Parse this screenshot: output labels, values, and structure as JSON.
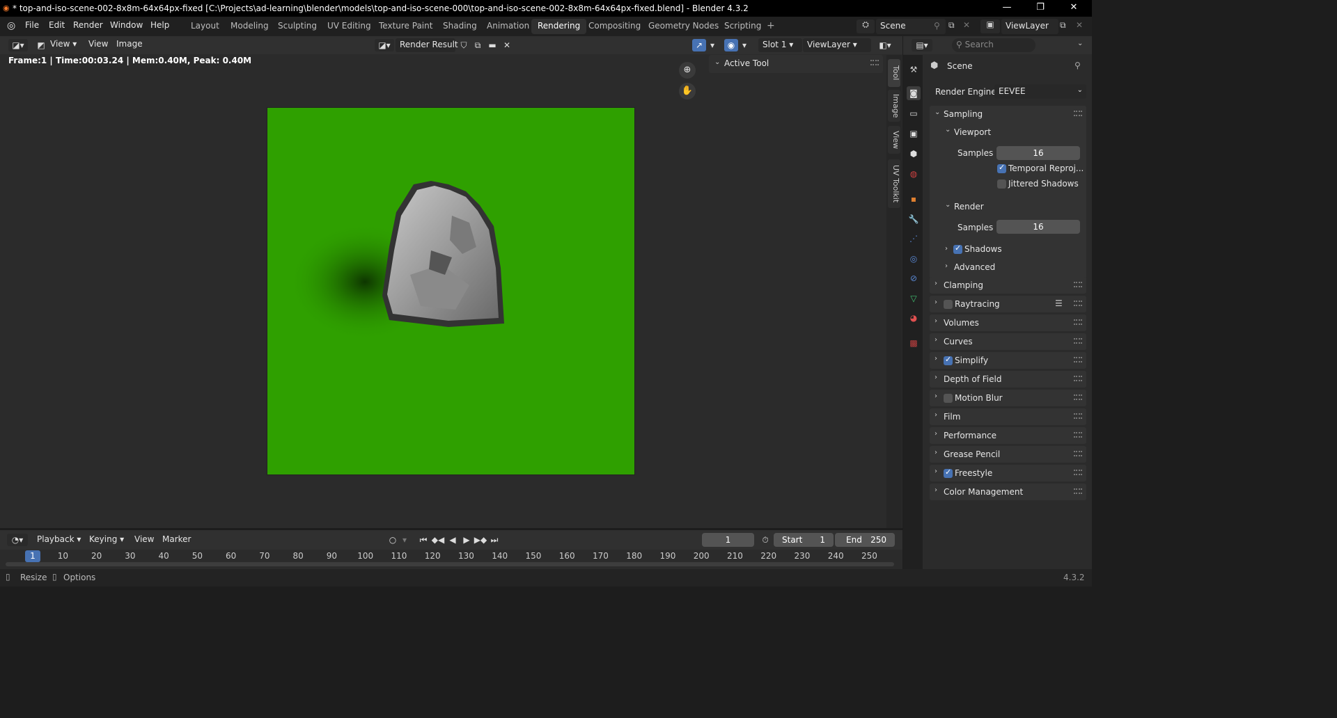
{
  "titlebar": {
    "title": "* top-and-iso-scene-002-8x8m-64x64px-fixed [C:\\Projects\\ad-learning\\blender\\models\\top-and-iso-scene-000\\top-and-iso-scene-002-8x8m-64x64px-fixed.blend] - Blender 4.3.2"
  },
  "menu": [
    "File",
    "Edit",
    "Render",
    "Window",
    "Help"
  ],
  "workspaces": [
    "Layout",
    "Modeling",
    "Sculpting",
    "UV Editing",
    "Texture Paint",
    "Shading",
    "Animation",
    "Rendering",
    "Compositing",
    "Geometry Nodes",
    "Scripting"
  ],
  "active_workspace": "Rendering",
  "scene": {
    "label": "Scene",
    "viewlayer": "ViewLayer"
  },
  "image_editor": {
    "view": "View",
    "view2": "View",
    "image": "Image",
    "render_result": "Render Result",
    "slot": "Slot 1",
    "viewlayer": "ViewLayer",
    "info": "Frame:1 | Time:00:03.24 | Mem:0.40M, Peak: 0.40M",
    "active_tool": "Active Tool",
    "vtabs": [
      "Tool",
      "Image",
      "View",
      "UV Toolkit"
    ]
  },
  "properties": {
    "search_placeholder": "Search",
    "scene": "Scene",
    "render_engine_label": "Render Engine",
    "render_engine": "EEVEE",
    "sampling": "Sampling",
    "viewport": "Viewport",
    "samples_label": "Samples",
    "viewport_samples": "16",
    "temporal": "Temporal Reproj...",
    "jittered": "Jittered Shadows",
    "render": "Render",
    "render_samples": "16",
    "shadows": "Shadows",
    "advanced": "Advanced",
    "panels": [
      "Clamping",
      "Raytracing",
      "Volumes",
      "Curves",
      "Simplify",
      "Depth of Field",
      "Motion Blur",
      "Film",
      "Performance",
      "Grease Pencil",
      "Freestyle",
      "Color Management"
    ]
  },
  "timeline": {
    "playback": "Playback",
    "keying": "Keying",
    "view": "View",
    "marker": "Marker",
    "current": "1",
    "start_label": "Start",
    "start": "1",
    "end_label": "End",
    "end": "250",
    "ticks": [
      "10",
      "20",
      "30",
      "40",
      "50",
      "60",
      "70",
      "80",
      "90",
      "100",
      "110",
      "120",
      "130",
      "140",
      "150",
      "160",
      "170",
      "180",
      "190",
      "200",
      "210",
      "220",
      "230",
      "240",
      "250"
    ]
  },
  "status": {
    "resize": "Resize",
    "options": "Options",
    "version": "4.3.2"
  }
}
